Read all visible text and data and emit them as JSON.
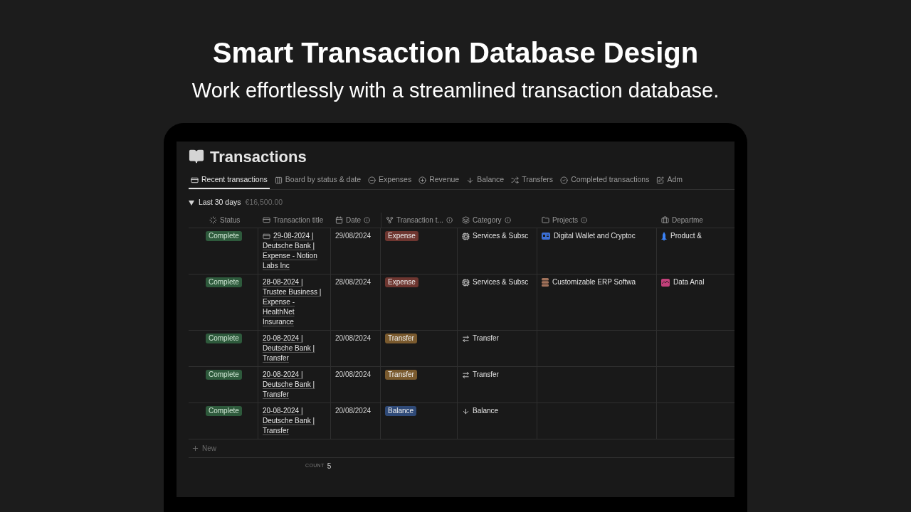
{
  "hero": {
    "title": "Smart Transaction Database Design",
    "subtitle": "Work effortlessly with a streamlined transaction database."
  },
  "page": {
    "title": "Transactions"
  },
  "tabs": [
    {
      "label": "Recent transactions",
      "selected": true
    },
    {
      "label": "Board by status & date",
      "selected": false
    },
    {
      "label": "Expenses",
      "selected": false
    },
    {
      "label": "Revenue",
      "selected": false
    },
    {
      "label": "Balance",
      "selected": false
    },
    {
      "label": "Transfers",
      "selected": false
    },
    {
      "label": "Completed transactions",
      "selected": false
    },
    {
      "label": "Adm",
      "selected": false
    }
  ],
  "group": {
    "label": "Last 30 days",
    "expanded": true,
    "total": "€16,500.00"
  },
  "columns": [
    {
      "label": "Status",
      "info": false
    },
    {
      "label": "Transaction title",
      "info": false
    },
    {
      "label": "Date",
      "info": true
    },
    {
      "label": "Transaction t...",
      "info": true
    },
    {
      "label": "Category",
      "info": true
    },
    {
      "label": "Projects",
      "info": true
    },
    {
      "label": "Departme",
      "info": false
    }
  ],
  "rows": [
    {
      "status": "Complete",
      "title": "29-08-2024 | Deutsche Bank | Expense - Notion Labs Inc",
      "title_icon": true,
      "date": "29/08/2024",
      "type": {
        "label": "Expense",
        "color": "#6e3630"
      },
      "category": {
        "label": "Services & Subsc",
        "kind": "service"
      },
      "project": {
        "label": "Digital Wallet and Cryptoc",
        "kind": "card",
        "color": "#3b6fd4"
      },
      "department": {
        "label": "Product &",
        "kind": "rocket",
        "color": "#3b82f6"
      }
    },
    {
      "status": "Complete",
      "title": "28-08-2024 | Trustee Business | Expense - HealthNet Insurance",
      "title_icon": false,
      "date": "28/08/2024",
      "type": {
        "label": "Expense",
        "color": "#6e3630"
      },
      "category": {
        "label": "Services & Subsc",
        "kind": "service"
      },
      "project": {
        "label": "Customizable ERP Softwa",
        "kind": "database",
        "color": "#a0715a"
      },
      "department": {
        "label": "Data Anal",
        "kind": "chart",
        "color": "#c2407a"
      }
    },
    {
      "status": "Complete",
      "title": "20-08-2024 | Deutsche Bank | Transfer",
      "title_icon": false,
      "date": "20/08/2024",
      "type": {
        "label": "Transfer",
        "color": "#7a5a2e"
      },
      "category": {
        "label": "Transfer",
        "kind": "transfer"
      }
    },
    {
      "status": "Complete",
      "title": "20-08-2024 | Deutsche Bank | Transfer",
      "title_icon": false,
      "date": "20/08/2024",
      "type": {
        "label": "Transfer",
        "color": "#7a5a2e"
      },
      "category": {
        "label": "Transfer",
        "kind": "transfer"
      }
    },
    {
      "status": "Complete",
      "title": "20-08-2024 | Deutsche Bank | Transfer",
      "title_icon": false,
      "date": "20/08/2024",
      "type": {
        "label": "Balance",
        "color": "#2f4a78"
      },
      "category": {
        "label": "Balance",
        "kind": "balance"
      }
    }
  ],
  "new_row": {
    "label": "New"
  },
  "footer": {
    "label": "COUNT",
    "value": "5"
  }
}
